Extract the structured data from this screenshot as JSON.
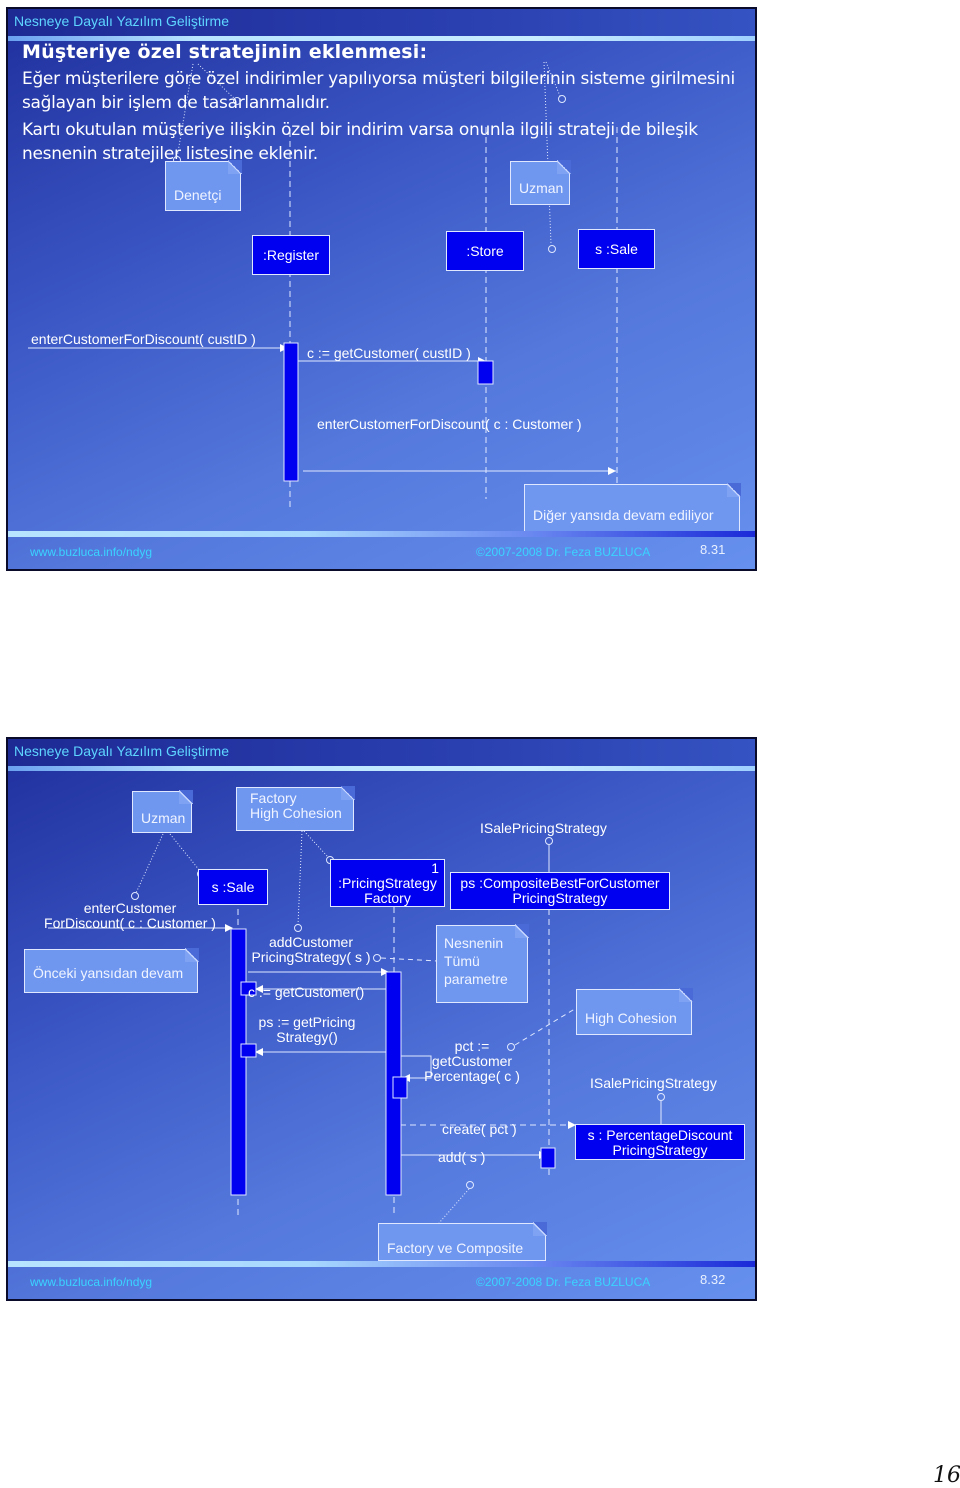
{
  "slides": [
    {
      "header_title": "Nesneye Dayalı Yazılım Geliştirme",
      "heading": "Müşteriye özel stratejinin eklenmesi:",
      "paragraphs": [
        "Eğer müşterilere göre özel indirimler yapılıyorsa müşteri bilgilerinin sisteme girilmesini sağlayan bir işlem de tasarlanmalıdır.",
        "Kartı okutulan müşteriye ilişkin özel bir indirim varsa onunla ilgili strateji de bileşik nesnenin stratejiler listesine eklenir."
      ],
      "notes": {
        "controller": "Denetçi",
        "expert": "Uzman",
        "continued": "Diğer yansıda devam ediliyor"
      },
      "objects": {
        "register": ":Register",
        "store": ":Store",
        "sale": "s :Sale"
      },
      "messages": {
        "m1": "enterCustomerForDiscount( custID )",
        "m2": "c := getCustomer( custID )",
        "m3": "enterCustomerForDiscount( c : Customer )"
      },
      "footer": {
        "url": "www.buzluca.info/ndyg",
        "copyright": "©2007-2008  Dr. Feza BUZLUCA",
        "slide_number": "8.31"
      }
    },
    {
      "header_title": "Nesneye Dayalı Yazılım Geliştirme",
      "notes": {
        "expert": "Uzman",
        "factory_line1": "Factory",
        "factory_line2": "High Cohesion",
        "previous": "Önceki yansıdan devam",
        "whole_line1": "Nesnenin",
        "whole_line2": "Tümü",
        "whole_line3": "parametre",
        "high_cohesion": "High Cohesion",
        "factory_composite": "Factory ve Composite"
      },
      "interfaces": {
        "top": "ISalePricingStrategy",
        "bottom": "ISalePricingStrategy"
      },
      "objects": {
        "sale": "s :Sale",
        "factory_mult": "1",
        "factory_line1": ":PricingStrategy",
        "factory_line2": "Factory",
        "composite_line1": "ps :CompositeBestForCustomer",
        "composite_line2": "PricingStrategy",
        "pct_line1": "s : PercentageDiscount",
        "pct_line2": "PricingStrategy"
      },
      "messages": {
        "m1_line1": "enterCustomer",
        "m1_line2": "ForDiscount( c : Customer )",
        "m2_line1": "addCustomer",
        "m2_line2": "PricingStrategy( s )",
        "m3": "c := getCustomer()",
        "m4_line1": "ps := getPricing",
        "m4_line2": "Strategy()",
        "m5_line1": "pct :=",
        "m5_line2": "getCustomer",
        "m5_line3": "Percentage( c )",
        "m6": "create( pct )",
        "m7": "add( s )"
      },
      "footer": {
        "url": "www.buzluca.info/ndyg",
        "copyright": "©2007-2008  Dr. Feza BUZLUCA",
        "slide_number": "8.32"
      }
    }
  ],
  "page_number": "16"
}
